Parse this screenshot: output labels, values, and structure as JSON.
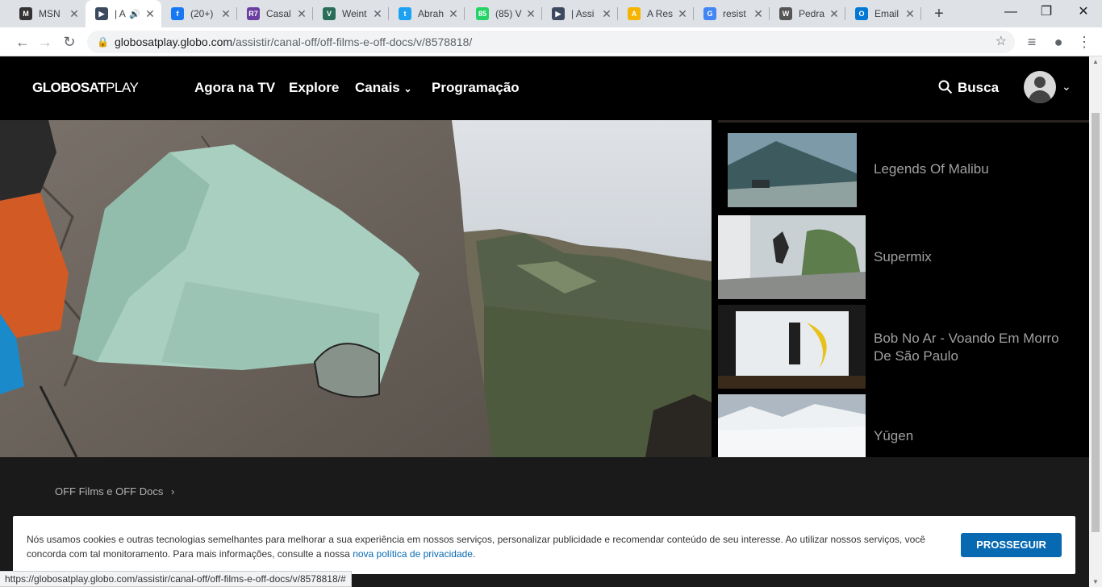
{
  "browser": {
    "tabs": [
      {
        "label": "MSN",
        "favicon": "msn-icon",
        "color": "#333333",
        "glyph": "M"
      },
      {
        "label": "| A",
        "favicon": "play-icon",
        "color": "#3c4a60",
        "glyph": "▶",
        "audio": true
      },
      {
        "label": "(20+)",
        "favicon": "facebook-icon",
        "color": "#1877f2",
        "glyph": "f"
      },
      {
        "label": "Casal",
        "favicon": "r7-icon",
        "color": "#6a3fa0",
        "glyph": "R7"
      },
      {
        "label": "Weint",
        "favicon": "valor-icon",
        "color": "#2a6e5a",
        "glyph": "V"
      },
      {
        "label": "Abrah",
        "favicon": "twitter-icon",
        "color": "#1da1f2",
        "glyph": "t"
      },
      {
        "label": "(85) V",
        "favicon": "whatsapp-icon",
        "color": "#25d366",
        "glyph": "85"
      },
      {
        "label": "| Assi",
        "favicon": "play-icon",
        "color": "#3c4a60",
        "glyph": "▶"
      },
      {
        "label": "A Res",
        "favicon": "drive-icon",
        "color": "#f4b400",
        "glyph": "A"
      },
      {
        "label": "resist",
        "favicon": "google-icon",
        "color": "#4285f4",
        "glyph": "G"
      },
      {
        "label": "Pedra",
        "favicon": "wikipedia-icon",
        "color": "#555555",
        "glyph": "W"
      },
      {
        "label": "Email",
        "favicon": "outlook-icon",
        "color": "#0078d4",
        "glyph": "O"
      }
    ],
    "url_host": "globosatplay.globo.com",
    "url_path": "/assistir/canal-off/off-films-e-off-docs/v/8578818/",
    "status_url": "https://globosatplay.globo.com/assistir/canal-off/off-films-e-off-docs/v/8578818/#"
  },
  "header": {
    "logo_bold": "GLOBOSAT",
    "logo_thin": "PLAY",
    "nav": [
      "Agora na TV",
      "Explore",
      "Canais",
      "Programação"
    ],
    "search_label": "Busca"
  },
  "playlist": [
    {
      "title": "Legends Of Malibu"
    },
    {
      "title": "Supermix"
    },
    {
      "title": "Bob No Ar - Voando Em Morro De São Paulo"
    },
    {
      "title": "Yūgen"
    }
  ],
  "breadcrumb": "OFF Films e OFF Docs",
  "cookie": {
    "text": "Nós usamos cookies e outras tecnologias semelhantes para melhorar a sua experiência em nossos serviços, personalizar publicidade e recomendar conteúdo de seu interesse. Ao utilizar nossos serviços, você concorda com tal monitoramento. Para mais informações, consulte a nossa",
    "link": "nova política de privacidade",
    "link_end": ".",
    "button": "PROSSEGUIR"
  }
}
